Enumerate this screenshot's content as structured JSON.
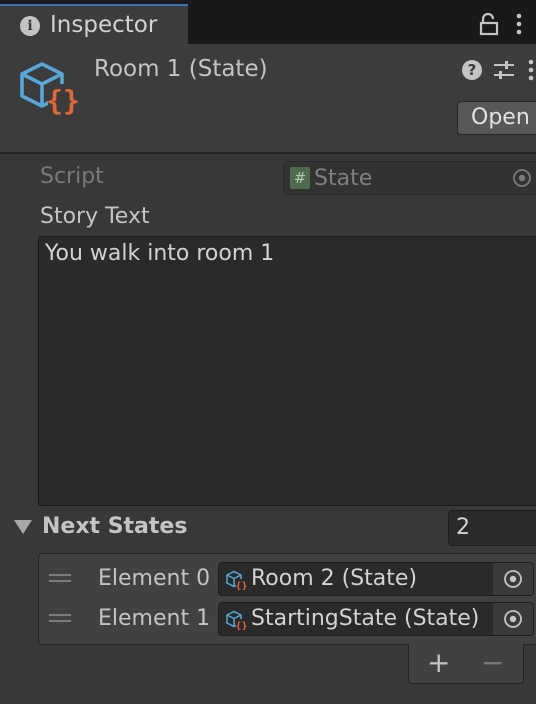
{
  "tab": {
    "title": "Inspector",
    "icon": "info-icon"
  },
  "header": {
    "title": "Room 1 (State)",
    "open_label": "Open",
    "icons": [
      "scriptable-object-icon",
      "help-icon",
      "presets-icon",
      "more-icon"
    ]
  },
  "fields": {
    "script_label": "Script",
    "script_value": "State",
    "story_label": "Story Text",
    "story_value": "You walk into room 1"
  },
  "next_states": {
    "label": "Next States",
    "size": "2",
    "elements": [
      {
        "label": "Element 0",
        "value": "Room 2 (State)"
      },
      {
        "label": "Element 1",
        "value": "StartingState (State)"
      }
    ],
    "add_label": "+",
    "remove_label": "−"
  },
  "colors": {
    "accent": "#3a72b0",
    "icon_blue": "#58a7d8",
    "icon_orange": "#e0673a"
  }
}
